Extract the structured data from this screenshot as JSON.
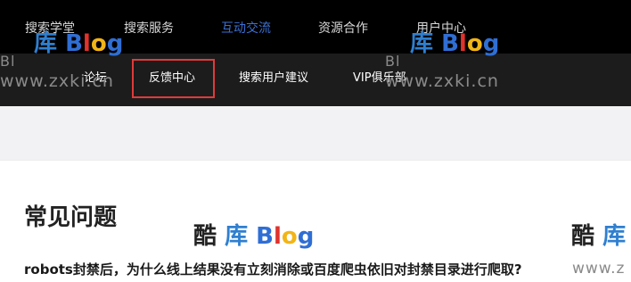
{
  "topnav": {
    "items": [
      {
        "label": "搜索学堂"
      },
      {
        "label": "搜索服务"
      },
      {
        "label": "互动交流"
      },
      {
        "label": "资源合作"
      },
      {
        "label": "用户中心"
      }
    ],
    "active_color": "#3b6fd1"
  },
  "subnav": {
    "items": [
      {
        "label": "论坛"
      },
      {
        "label": "反馈中心"
      },
      {
        "label": "搜索用户建议"
      },
      {
        "label": "VIP俱乐部"
      }
    ],
    "highlighted": "反馈中心",
    "highlight_color": "#e03a3a"
  },
  "content": {
    "title": "常见问题",
    "question": "robots封禁后，为什么线上结果没有立刻消除或百度爬虫依旧对封禁目录进行爬取?"
  },
  "watermark": {
    "char_ku": "库",
    "char_ku2": "酷",
    "blog": [
      "B",
      "l",
      "o",
      "g"
    ],
    "url": "www.zxki.cn",
    "partial_left": "Bl",
    "partial_url_right": "www.z"
  }
}
